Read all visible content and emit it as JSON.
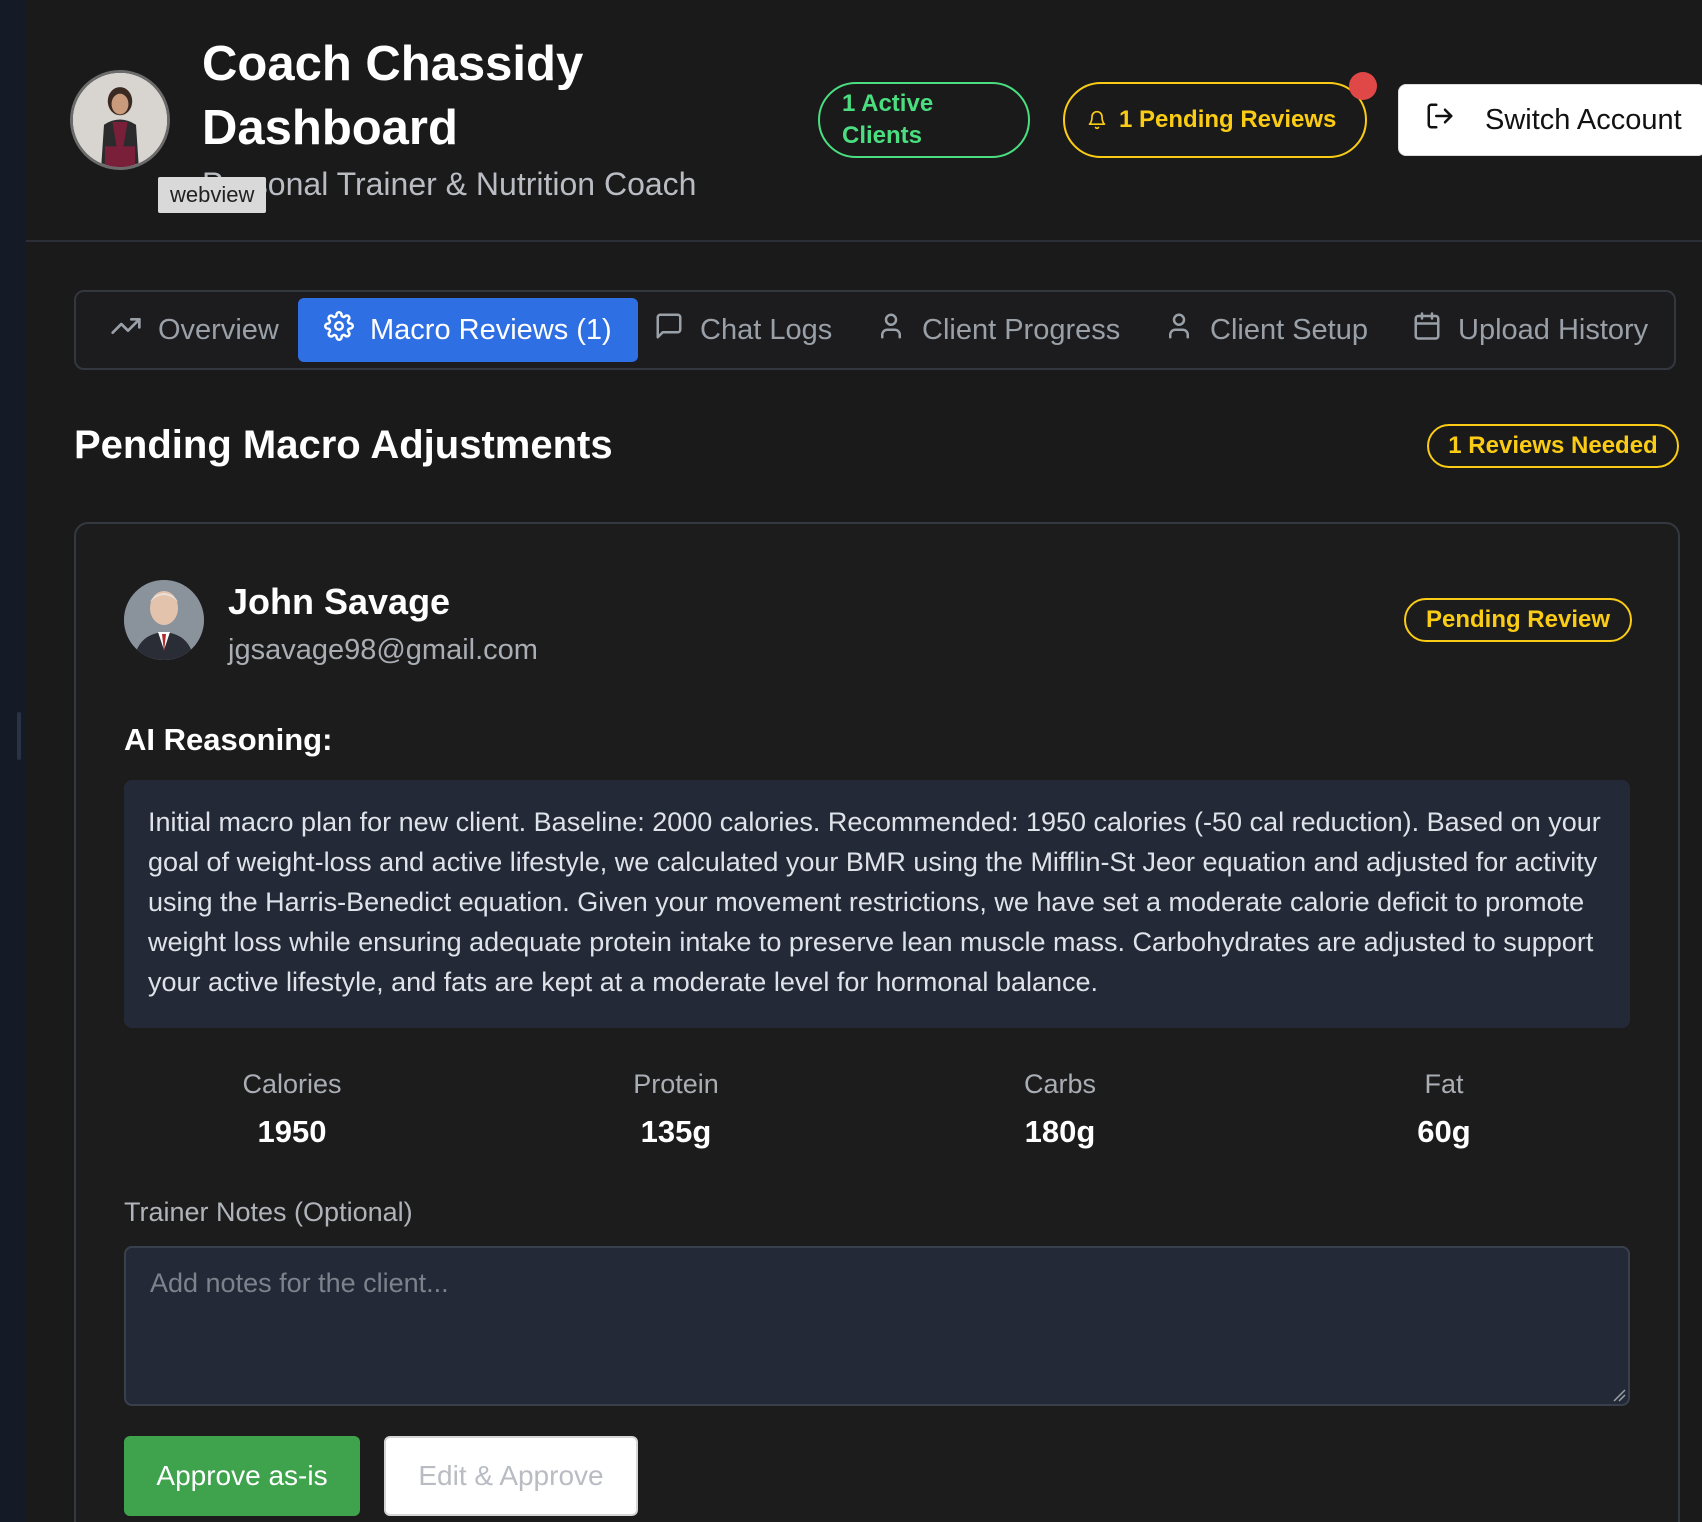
{
  "header": {
    "title": "Coach Chassidy Dashboard",
    "subtitle": "Personal Trainer & Nutrition Coach",
    "webview_tag": "webview",
    "active_clients": "1 Active Clients",
    "pending_reviews": "1 Pending Reviews",
    "switch_account": "Switch Account"
  },
  "tabs": [
    {
      "label": "Overview",
      "icon": "trending-up-icon"
    },
    {
      "label": "Macro Reviews (1)",
      "icon": "gear-icon",
      "active": true
    },
    {
      "label": "Chat Logs",
      "icon": "chat-icon"
    },
    {
      "label": "Client Progress",
      "icon": "user-icon"
    },
    {
      "label": "Client Setup",
      "icon": "user-icon"
    },
    {
      "label": "Upload History",
      "icon": "calendar-icon"
    }
  ],
  "section": {
    "title": "Pending Macro Adjustments",
    "badge": "1 Reviews Needed"
  },
  "review": {
    "client_name": "John Savage",
    "client_email": "jgsavage98@gmail.com",
    "status": "Pending Review",
    "ai_label": "AI Reasoning:",
    "ai_reasoning": "Initial macro plan for new client. Baseline: 2000 calories. Recommended: 1950 calories (-50 cal reduction). Based on your goal of weight-loss and active lifestyle, we calculated your BMR using the Mifflin-St Jeor equation and adjusted for activity using the Harris-Benedict equation. Given your movement restrictions, we have set a moderate calorie deficit to promote weight loss while ensuring adequate protein intake to preserve lean muscle mass. Carbohydrates are adjusted to support your active lifestyle, and fats are kept at a moderate level for hormonal balance.",
    "macros": [
      {
        "label": "Calories",
        "value": "1950"
      },
      {
        "label": "Protein",
        "value": "135g"
      },
      {
        "label": "Carbs",
        "value": "180g"
      },
      {
        "label": "Fat",
        "value": "60g"
      }
    ],
    "notes_label": "Trainer Notes (Optional)",
    "notes_placeholder": "Add notes for the client...",
    "notes_value": "",
    "approve_label": "Approve as-is",
    "edit_label": "Edit & Approve"
  },
  "colors": {
    "background": "#1a1a1a",
    "accent_blue": "#2f6fe4",
    "green": "#4ade80",
    "yellow": "#facc15",
    "approve_green": "#3fa34d",
    "notification_red": "#e04848"
  }
}
